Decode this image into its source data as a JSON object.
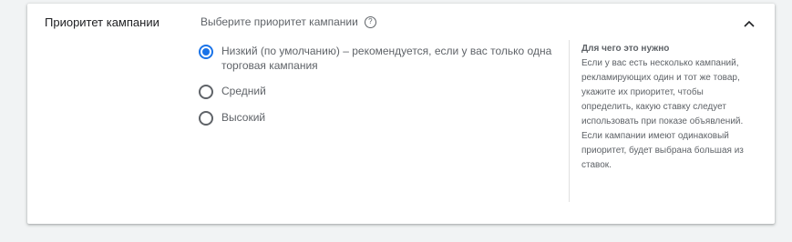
{
  "section": {
    "title": "Приоритет кампании",
    "prompt": "Выберите приоритет кампании",
    "help_icon_glyph": "?",
    "collapse_icon": "chevron-up-icon"
  },
  "options": [
    {
      "label": "Низкий (по умолчанию) – рекомендуется, если у вас только одна торговая кампания",
      "checked": true
    },
    {
      "label": "Средний",
      "checked": false
    },
    {
      "label": "Высокий",
      "checked": false
    }
  ],
  "help_panel": {
    "title": "Для чего это нужно",
    "body": "Если у вас есть несколько кампаний, рекламирующих один и тот же товар, укажите их приоритет, чтобы определить, какую ставку следует использовать при показе объявлений. Если кампании имеют одинаковый приоритет, будет выбрана большая из ставок."
  },
  "colors": {
    "accent": "#1a73e8",
    "text_primary": "#202124",
    "text_secondary": "#5f6368",
    "background": "#f1f3f4"
  }
}
